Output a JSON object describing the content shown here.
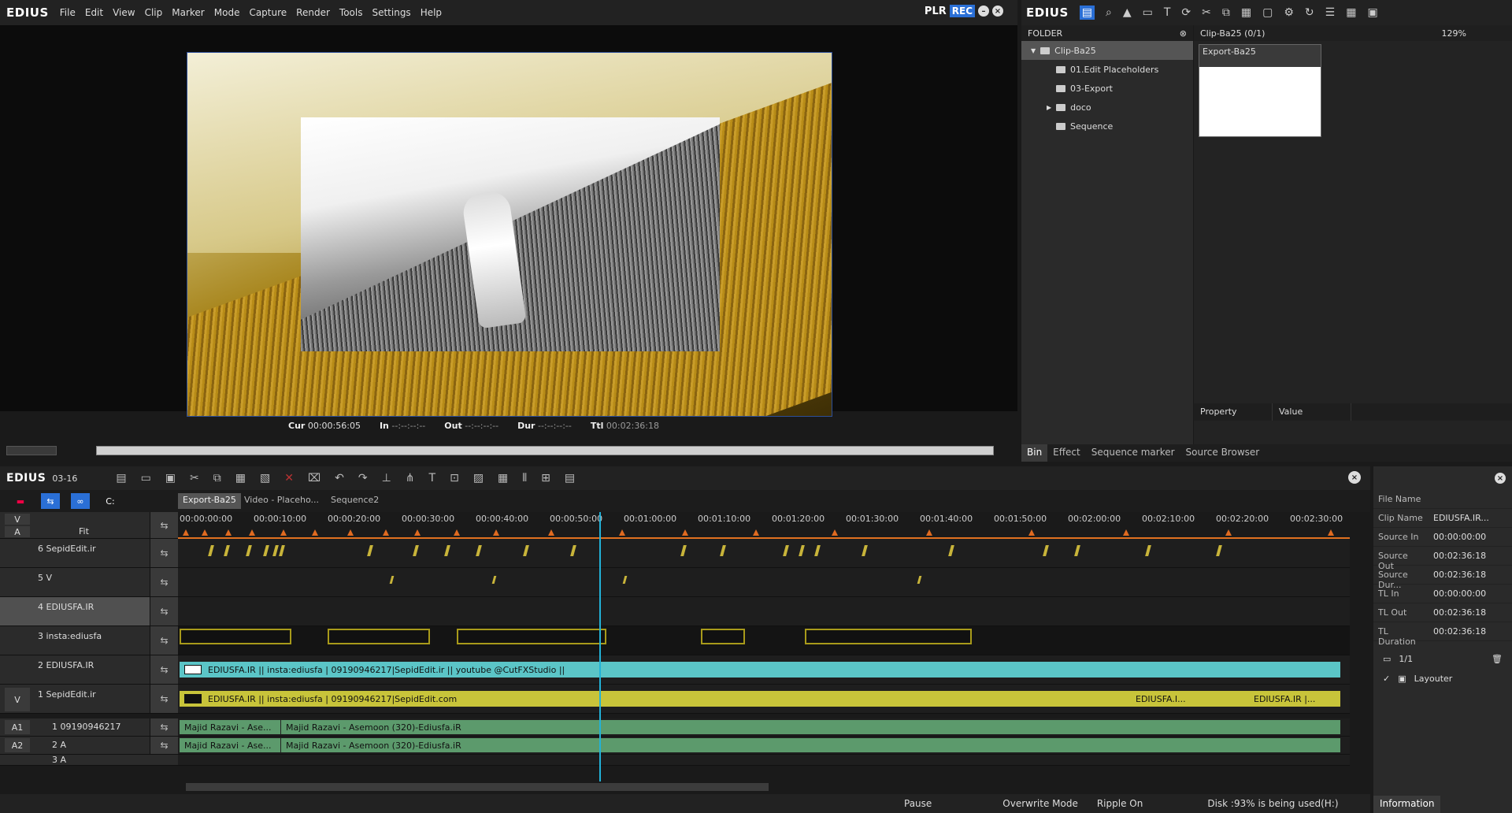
{
  "app": {
    "name": "EDIUS"
  },
  "menu": [
    "File",
    "Edit",
    "View",
    "Clip",
    "Marker",
    "Mode",
    "Capture",
    "Render",
    "Tools",
    "Settings",
    "Help"
  ],
  "player": {
    "plr_label": "PLR",
    "rec_label": "REC"
  },
  "timecode": {
    "cur_label": "Cur",
    "cur": "00:00:56:05",
    "in_label": "In",
    "in": "--:--:--:--",
    "out_label": "Out",
    "out": "--:--:--:--",
    "dur_label": "Dur",
    "dur": "--:--:--:--",
    "ttl_label": "Ttl",
    "ttl": "00:02:36:18"
  },
  "bin": {
    "title": "EDIUS",
    "folder_header": "FOLDER",
    "tree": [
      {
        "label": "Clip-Ba25",
        "level": 0,
        "selected": true
      },
      {
        "label": "01.Edit Placeholders",
        "level": 1
      },
      {
        "label": "03-Export",
        "level": 1
      },
      {
        "label": "doco",
        "level": 1
      },
      {
        "label": "Sequence",
        "level": 1
      }
    ],
    "clip_header": "Clip-Ba25 (0/1)",
    "zoom": "129%",
    "clip_name": "Export-Ba25",
    "prop_col": "Property",
    "value_col": "Value",
    "tabs": [
      "Bin",
      "Effect",
      "Sequence marker",
      "Source Browser"
    ]
  },
  "timeline": {
    "title": "EDIUS",
    "seq_id": "03-16",
    "fit_label": "Fit",
    "seq_tabs": [
      "Export-Ba25",
      "Video - Placeho...",
      "Sequence2"
    ],
    "ruler": [
      "00:00:00:00",
      "00:00:10:00",
      "00:00:20:00",
      "00:00:30:00",
      "00:00:40:00",
      "00:00:50:00",
      "00:01:00:00",
      "00:01:10:00",
      "00:01:20:00",
      "00:01:30:00",
      "00:01:40:00",
      "00:01:50:00",
      "00:02:00:00",
      "00:02:10:00",
      "00:02:20:00",
      "00:02:30:00"
    ],
    "v_label": "V",
    "a_label": "A",
    "tracks": [
      {
        "name": "6 SepidEdit.ir"
      },
      {
        "name": "5 V"
      },
      {
        "name": "4 EDIUSFA.IR"
      },
      {
        "name": "3 insta:ediusfa"
      },
      {
        "name": "2 EDIUSFA.IR"
      },
      {
        "name": "1 SepidEdit.ir"
      }
    ],
    "audio_tracks": [
      {
        "id": "A1",
        "name": "1 09190946217"
      },
      {
        "id": "A2",
        "name": "2 A"
      },
      {
        "name": "3 A"
      }
    ],
    "clip_track2": "EDIUSFA.IR || insta:ediusfa |  09190946217|SepidEdit.ir  || youtube @CutFXStudio ||",
    "clip_track1": "EDIUSFA.IR || insta:ediusfa |  09190946217|SepidEdit.com",
    "clip_track1_b": "EDIUSFA.I...",
    "clip_track1_c": "EDIUSFA.IR |...",
    "audio_clip_a": "Majid Razavi - Ase...",
    "audio_clip_b": "Majid Razavi - Asemoon (320)-Ediusfa.iR",
    "track1_v": "V"
  },
  "status": {
    "pause": "Pause",
    "mode": "Overwrite Mode",
    "ripple": "Ripple On",
    "disk": "Disk :93% is being used(H:)"
  },
  "info": {
    "rows": [
      {
        "k": "File Name",
        "v": ""
      },
      {
        "k": "Clip Name",
        "v": "EDIUSFA.IR..."
      },
      {
        "k": "Source In",
        "v": "00:00:00:00"
      },
      {
        "k": "Source Out",
        "v": "00:02:36:18"
      },
      {
        "k": "Source Dur...",
        "v": "00:02:36:18"
      },
      {
        "k": "TL In",
        "v": "00:00:00:00"
      },
      {
        "k": "TL Out",
        "v": "00:02:36:18"
      },
      {
        "k": "TL Duration",
        "v": "00:02:36:18"
      }
    ],
    "page": "1/1",
    "effect": "Layouter",
    "tab": "Information"
  }
}
